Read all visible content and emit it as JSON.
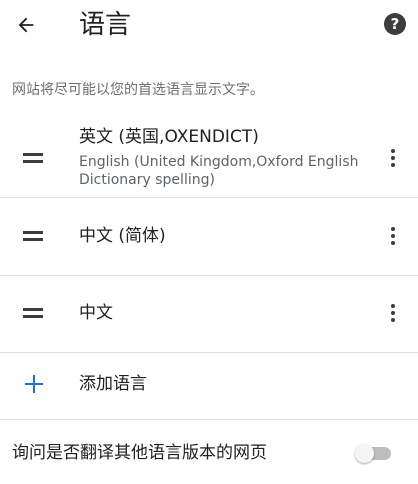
{
  "header": {
    "title": "语言",
    "back_icon": "arrow-left-icon",
    "help_icon": "question-circle-icon",
    "help_glyph": "?"
  },
  "description": "网站将尽可能以您的首选语言显示文字。",
  "languages": [
    {
      "name": "英文 (英国,OXENDICT)",
      "subtitle": "English (United Kingdom,Oxford English Dictionary spelling)"
    },
    {
      "name": "中文 (简体)",
      "subtitle": ""
    },
    {
      "name": "中文",
      "subtitle": ""
    }
  ],
  "add_language": {
    "label": "添加语言",
    "icon": "plus-icon",
    "color": "#1a73e8"
  },
  "translate_offer": {
    "label": "询问是否翻译其他语言版本的网页",
    "enabled": false
  }
}
